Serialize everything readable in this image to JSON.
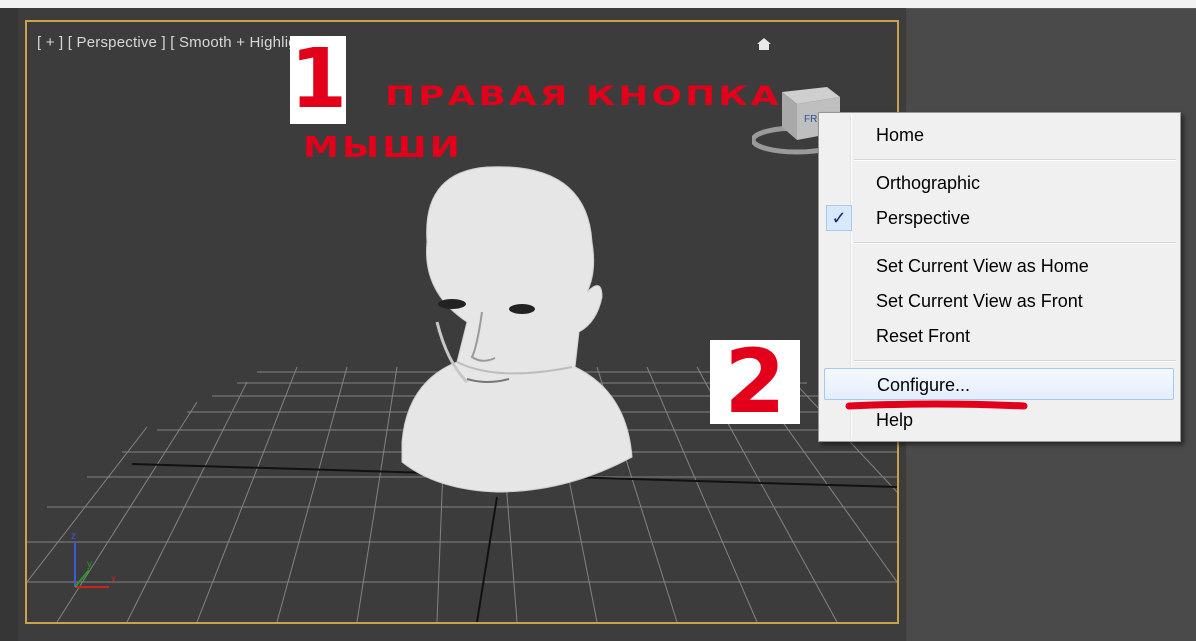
{
  "viewport": {
    "label": "[ + ] [ Perspective ] [ Smooth + Highlights ]",
    "home_icon": "house-icon",
    "viewcube_face": "FRONT"
  },
  "annotations": {
    "step1_number": "1",
    "step1_text_line1": "правая кнопка",
    "step1_text_line2": "мыши",
    "step2_number": "2",
    "color": "#e2001a"
  },
  "context_menu": {
    "items": [
      {
        "label": "Home"
      },
      {
        "label": "Orthographic"
      },
      {
        "label": "Perspective",
        "checked": true
      },
      {
        "label": "Set Current View as Home"
      },
      {
        "label": "Set Current View as Front"
      },
      {
        "label": "Reset Front"
      },
      {
        "label": "Configure...",
        "highlighted": true
      },
      {
        "label": "Help"
      }
    ],
    "check_mark": "✓"
  },
  "colors": {
    "viewport_border": "#c9a24a",
    "viewport_bg": "#3c3c3c",
    "menu_bg": "#f0f0f0"
  }
}
